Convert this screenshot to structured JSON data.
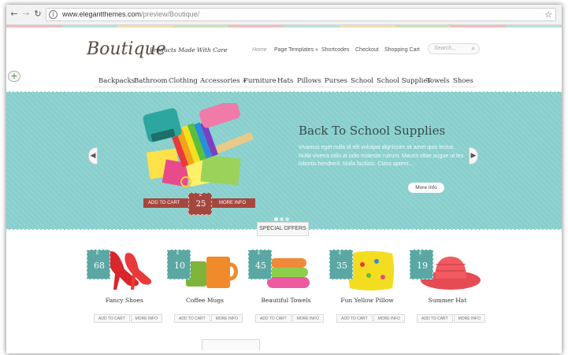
{
  "browser": {
    "back_icon": "arrow-left-icon",
    "forward_icon": "arrow-right-icon",
    "reload_icon": "reload-icon",
    "url_host": "www.elegantthemes.com",
    "url_path": "/preview/Boutique/",
    "star_icon": "star-icon"
  },
  "header": {
    "logo": "Boutique",
    "tagline": "Products Made With Care",
    "nav": [
      "Home",
      "Page Templates »",
      "Shortcodes",
      "Checkout",
      "Shopping Cart"
    ],
    "search_placeholder": "Search..."
  },
  "categories": [
    "Backpacks",
    "Bathroom",
    "Clothing",
    "Accessories »",
    "Furniture",
    "Hats",
    "Pillows",
    "Purses",
    "School",
    "School Supplies",
    "Towels",
    "Shoes"
  ],
  "slider": {
    "title": "Back To School Supplies",
    "description": "Vivamus eget nulla id elit volutpat dignissim sit amet quis lectus. Nulla viverra odio at odio molestie rutrum. Mauris vitae augue ut leo lobortis hendrerit. Nulla facilisis. Class aptent...",
    "more_info": "More Info",
    "add_to_cart": "ADD TO CART",
    "more_info_small": "MORE INFO",
    "currency": "£",
    "price": "25",
    "slide_count": 3,
    "active_slide": 1,
    "colors": {
      "slider_bg": "#88cfcd",
      "ribbon": "#a4473e",
      "price_tag": "#5aa7a3"
    }
  },
  "special_offers": "SPECIAL OFFERS",
  "products": [
    {
      "name": "Fancy Shoes",
      "price": "68",
      "currency": "£",
      "add": "ADD TO CART",
      "more": "MORE INFO"
    },
    {
      "name": "Coffee Mugs",
      "price": "10",
      "currency": "£",
      "add": "ADD TO CART",
      "more": "MORE INFO"
    },
    {
      "name": "Beautiful Towels",
      "price": "45",
      "currency": "£",
      "add": "ADD TO CART",
      "more": "MORE INFO"
    },
    {
      "name": "Fun Yellow Pillow",
      "price": "35",
      "currency": "£",
      "add": "ADD TO CART",
      "more": "MORE INFO"
    },
    {
      "name": "Summer Hat",
      "price": "19",
      "currency": "£",
      "add": "ADD TO CART",
      "more": "MORE INFO"
    }
  ]
}
